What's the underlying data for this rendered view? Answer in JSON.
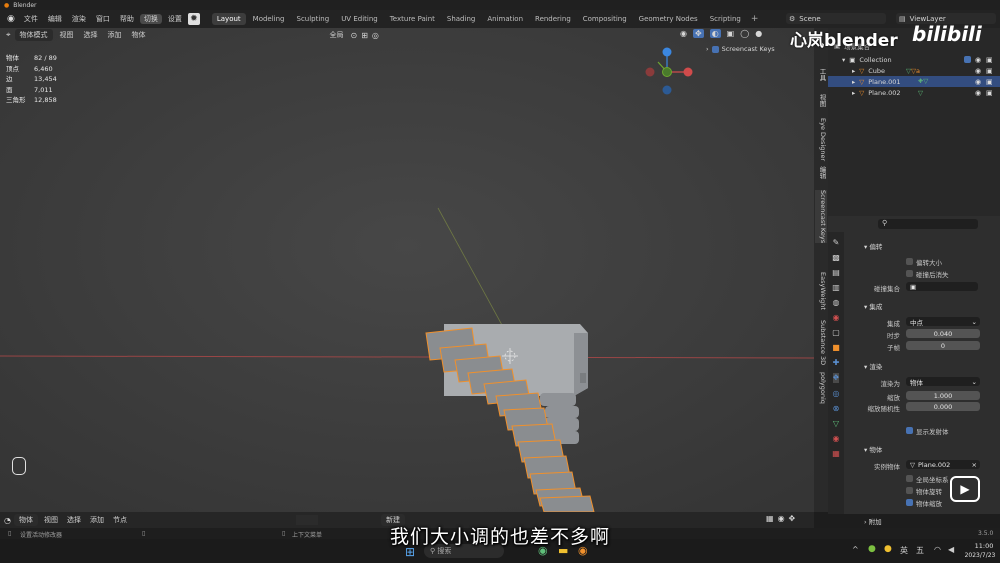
{
  "window": {
    "title": "Blender"
  },
  "menubar": {
    "items": [
      "文件",
      "编辑",
      "渲染",
      "窗口",
      "帮助"
    ],
    "switch_label": "切换",
    "settings_label": "设置"
  },
  "workspaces": [
    "Layout",
    "Modeling",
    "Sculpting",
    "UV Editing",
    "Texture Paint",
    "Shading",
    "Animation",
    "Rendering",
    "Compositing",
    "Geometry Nodes",
    "Scripting"
  ],
  "active_workspace": "Layout",
  "scene": {
    "name": "Scene",
    "view_layer": "ViewLayer"
  },
  "viewport_header": {
    "mode": "物体模式",
    "menus": [
      "视图",
      "选择",
      "添加",
      "物体"
    ],
    "orientation": "全局"
  },
  "stats": [
    {
      "label": "物体",
      "value": "82 / 89"
    },
    {
      "label": "顶点",
      "value": "6,460"
    },
    {
      "label": "边",
      "value": "13,454"
    },
    {
      "label": "面",
      "value": "7,011"
    },
    {
      "label": "三角形",
      "value": "12,858"
    }
  ],
  "screencast": {
    "label": "Screencast Keys",
    "enabled": true
  },
  "side_tabs": [
    "工具",
    "视图",
    "Eye Designer",
    "编辑",
    "Screencast Keys",
    "EasyWeight",
    "Substance 3D",
    "polygoniq"
  ],
  "outliner": {
    "root": "场景集合",
    "collection": "Collection",
    "objects": [
      {
        "name": "Cube",
        "selected": false
      },
      {
        "name": "Plane.001",
        "selected": true
      },
      {
        "name": "Plane.002",
        "selected": false
      }
    ]
  },
  "properties": {
    "search_placeholder": "",
    "sections": {
      "rotation": {
        "title": "偏转",
        "items": [
          {
            "label": "偏转大小",
            "checked": false
          },
          {
            "label": "碰撞后消失",
            "checked": false
          }
        ],
        "collision_collection_label": "碰撞集合"
      },
      "integration": {
        "title": "集成",
        "integration_label": "集成",
        "integration_value": "中点",
        "timestep_label": "时步",
        "timestep_value": "0.040",
        "substeps_label": "子帧",
        "substeps_value": "0"
      },
      "render": {
        "title": "渲染",
        "render_as_label": "渲染为",
        "render_as_value": "物体",
        "scale_label": "缩放",
        "scale_value": "1.000",
        "scale_random_label": "缩放随机性",
        "scale_random_value": "0.000",
        "show_emitter_label": "显示发射体",
        "show_emitter_checked": true
      },
      "object": {
        "title": "物体",
        "instance_label": "实例物体",
        "instance_value": "Plane.002",
        "global_coords_label": "全局坐标系",
        "global_coords_checked": false,
        "object_rotation_label": "物体旋转",
        "object_rotation_checked": false,
        "object_scale_label": "物体缩放",
        "object_scale_checked": true
      },
      "extra": {
        "title": "附加"
      }
    }
  },
  "timeline": {
    "mode": "物体",
    "menus": [
      "视图",
      "选择",
      "添加",
      "节点"
    ],
    "new_label": "新建"
  },
  "status": {
    "left": "设置活动修改器",
    "middle": "上下文菜单",
    "version": "3.5.0"
  },
  "taskbar": {
    "search_placeholder": "搜索",
    "time": "11:00",
    "date": "2023/7/23",
    "ime1": "英",
    "ime2": "五"
  },
  "overlay": {
    "watermark": "心岚blender",
    "bili": "bilibili",
    "subtitle": "我们大小调的也差不多啊"
  },
  "colors": {
    "selected_outline": "#f0902c",
    "accent_blue": "#4772b3",
    "axis_x": "#d04b4b",
    "axis_y": "#6ea82f",
    "axis_z": "#3b87e0"
  }
}
